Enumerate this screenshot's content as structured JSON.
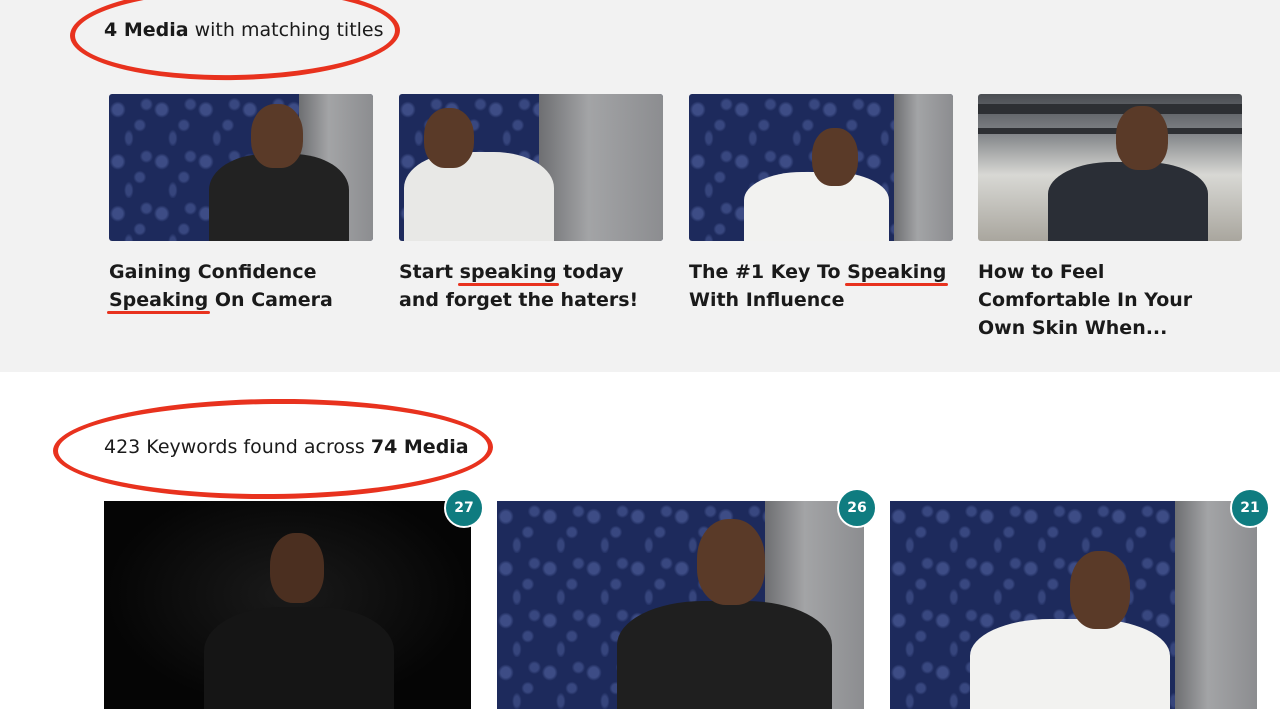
{
  "matching_titles": {
    "count": "4 Media",
    "suffix": " with matching titles",
    "highlight_color": "#e8321e",
    "items": [
      {
        "title_before": "Gaining Confidence ",
        "title_highlight": "Speaking",
        "title_after": " On Camera"
      },
      {
        "title_before": "Start ",
        "title_highlight": "speaking",
        "title_after": " today and forget the haters!"
      },
      {
        "title_before": "The #1 Key To ",
        "title_highlight": "Speaking",
        "title_after": " With Influence"
      },
      {
        "title_before": "How to Feel Comfortable In Your Own Skin When...",
        "title_highlight": "",
        "title_after": ""
      }
    ]
  },
  "keywords": {
    "prefix": "423 Keywords found across ",
    "media_count": "74 Media",
    "badge_color": "#0f7c80",
    "items": [
      {
        "count": "27"
      },
      {
        "count": "26"
      },
      {
        "count": "21"
      }
    ]
  },
  "colors": {
    "top_background": "#f2f2f2",
    "bottom_background": "#ffffff",
    "annotation_red": "#e8321e"
  }
}
